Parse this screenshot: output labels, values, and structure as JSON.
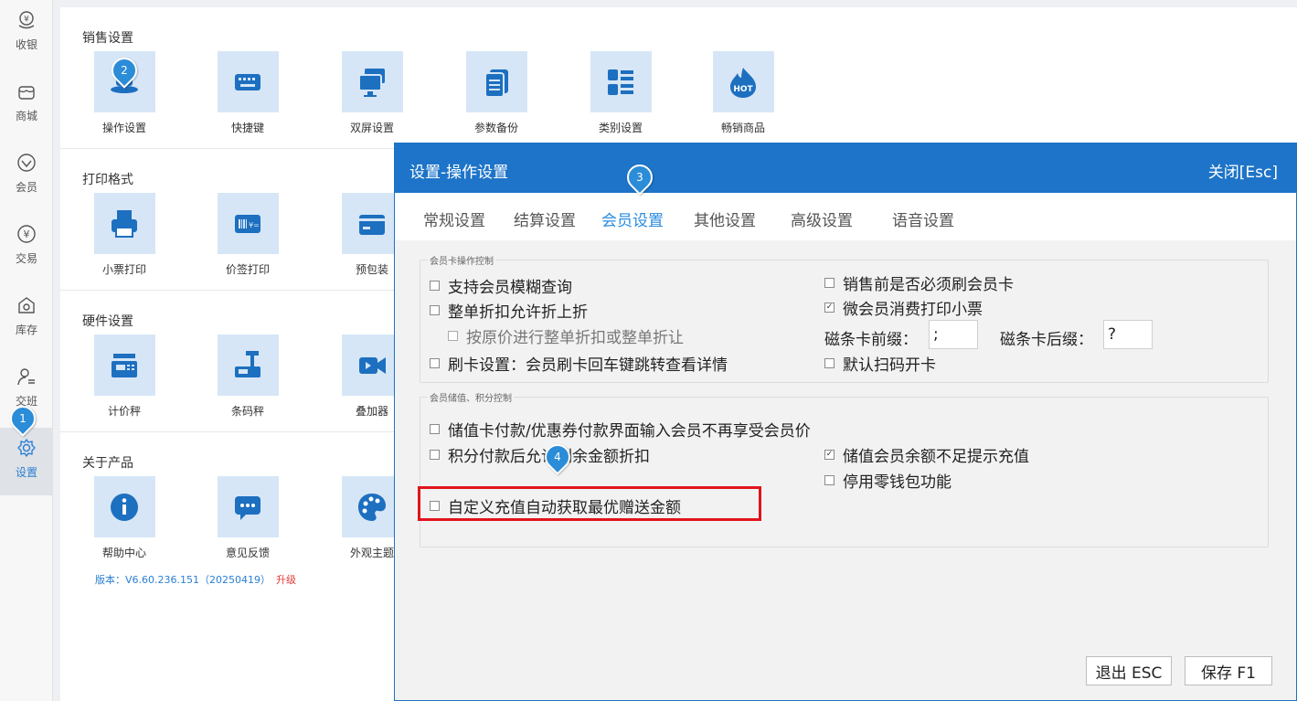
{
  "rail": {
    "items": [
      {
        "label": "收银",
        "icon": "cashier-icon"
      },
      {
        "label": "商城",
        "icon": "shop-icon"
      },
      {
        "label": "会员",
        "icon": "member-icon"
      },
      {
        "label": "交易",
        "icon": "transaction-icon"
      },
      {
        "label": "库存",
        "icon": "inventory-icon"
      },
      {
        "label": "交班",
        "icon": "shift-icon"
      },
      {
        "label": "设置",
        "icon": "gear-icon"
      }
    ]
  },
  "sections": {
    "sales": {
      "title": "销售设置",
      "tiles": [
        "操作设置",
        "快捷键",
        "双屏设置",
        "参数备份",
        "类别设置",
        "畅销商品"
      ]
    },
    "print": {
      "title": "打印格式",
      "tiles": [
        "小票打印",
        "价签打印",
        "预包装"
      ]
    },
    "hardware": {
      "title": "硬件设置",
      "tiles": [
        "计价秤",
        "条码秤",
        "叠加器"
      ]
    },
    "about": {
      "title": "关于产品",
      "tiles": [
        "帮助中心",
        "意见反馈",
        "外观主题"
      ]
    }
  },
  "hot_badge": "HOT",
  "version": {
    "text": "版本：V6.60.236.151（20250419）",
    "upgrade": "升级"
  },
  "dialog": {
    "title": "设置-操作设置",
    "close": "关闭[Esc]",
    "tabs": [
      "常规设置",
      "结算设置",
      "会员设置",
      "其他设置",
      "高级设置",
      "语音设置"
    ],
    "active_tab": "会员设置",
    "group1": {
      "legend": "会员卡操作控制",
      "left": [
        {
          "label": "支持会员模糊查询",
          "checked": false
        },
        {
          "label": "整单折扣允许折上折",
          "checked": false
        },
        {
          "label": "按原价进行整单折扣或整单折让",
          "checked": false,
          "disabled": true
        },
        {
          "label": "刷卡设置：会员刷卡回车键跳转查看详情",
          "checked": false
        }
      ],
      "right": [
        {
          "label": "销售前是否必须刷会员卡",
          "checked": false
        },
        {
          "label": "微会员消费打印小票",
          "checked": true
        },
        {
          "label": "默认扫码开卡",
          "checked": false
        }
      ],
      "prefix_label": "磁条卡前缀：",
      "prefix_value": ";",
      "suffix_label": "磁条卡后缀：",
      "suffix_value": "?"
    },
    "group2": {
      "legend": "会员储值、积分控制",
      "left": [
        {
          "label": "储值卡付款/优惠券付款界面输入会员不再享受会员价",
          "checked": false
        },
        {
          "label": "积分付款后允许剩余金额折扣",
          "checked": false
        },
        {
          "label": "自定义充值自动获取最优赠送金额",
          "checked": false
        }
      ],
      "right": [
        {
          "label": "储值会员余额不足提示充值",
          "checked": true
        },
        {
          "label": "停用零钱包功能",
          "checked": false
        }
      ]
    },
    "buttons": {
      "exit": "退出 ESC",
      "save": "保存 F1"
    }
  },
  "markers": [
    "1",
    "2",
    "3",
    "4"
  ],
  "colors": {
    "accent": "#1d74c8",
    "tile_bg": "#d6e6f6",
    "icon": "#1d6fc0",
    "highlight_box": "#e0141b"
  }
}
